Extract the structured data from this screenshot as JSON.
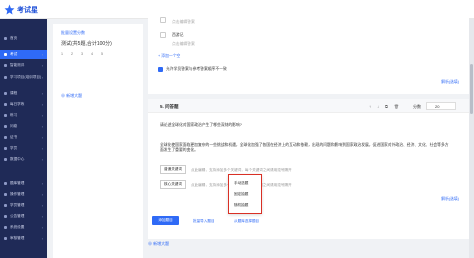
{
  "app": {
    "logo_text": "考试星"
  },
  "topbar": {
    "user": "靖哥用户名"
  },
  "sidebar": {
    "items": [
      {
        "label": "首页",
        "active": false,
        "has_arrow": false
      },
      {
        "label": "考试",
        "active": true,
        "has_arrow": true
      },
      {
        "label": "智能测评",
        "active": false,
        "has_arrow": true
      },
      {
        "label": "学习项目(培训项目)",
        "active": false,
        "has_arrow": true
      },
      {
        "label": "课程",
        "active": false,
        "has_arrow": true
      },
      {
        "label": "每日学练",
        "active": false,
        "has_arrow": true
      },
      {
        "label": "练习",
        "active": false,
        "has_arrow": true
      },
      {
        "label": "问卷",
        "active": false,
        "has_arrow": true
      },
      {
        "label": "证书",
        "active": false,
        "has_arrow": true
      },
      {
        "label": "学员",
        "active": false,
        "has_arrow": true
      },
      {
        "label": "数据中心",
        "active": false,
        "has_arrow": true
      },
      {
        "label": "题库管理",
        "active": false,
        "has_arrow": true
      },
      {
        "label": "操作管理",
        "active": false,
        "has_arrow": true
      },
      {
        "label": "学员管理",
        "active": false,
        "has_arrow": true
      },
      {
        "label": "公告管理",
        "active": false,
        "has_arrow": true
      },
      {
        "label": "系统设置",
        "active": false,
        "has_arrow": true
      },
      {
        "label": "审核管理",
        "active": false,
        "has_arrow": true
      }
    ]
  },
  "leftpanel": {
    "link": "批量设置分数",
    "title": "测试(共5题,合计100分)",
    "nums": [
      "1",
      "2",
      "3",
      "4",
      "5"
    ],
    "add": "新增大题"
  },
  "options": {
    "opt1_placeholder": "点击编辑答案",
    "opt2_text": "西游记",
    "opt2_placeholder": "点击编辑答案",
    "add_option": "添加一个空",
    "checkbox_label": "允许学员答案与参考答案顺序不一致",
    "parse_link": "解析(选填)"
  },
  "question": {
    "title": "5. 问答题",
    "score_label": "分数",
    "score": "20",
    "text1": "请论述全球化对国家政治产生了哪些深刻的影响?",
    "text2": "全球化使国家面临更加复杂的一些挑战和机遇，全球化加强了各国在经济上的互动和依赖，出现的问题和影响到国家政治发展，促进国家对外政治、经济、文化、社会等多方面发生了重要的变化。",
    "kw_btn1": "普通关键词",
    "kw_ph1": "点此编辑，支持添加多个关键词，每个关键词之间请用逗号隔开",
    "kw_btn2": "核心关键词",
    "kw_ph2": "点此编辑，支持添加多个关键词，每个关键词之间请用逗号隔开",
    "parse_link": "解析(选填)"
  },
  "dropdown": {
    "items": [
      "手动选题",
      "固定抽题",
      "随机抽题"
    ]
  },
  "actions": {
    "primary": "添加题目",
    "link1": "批量导入题目",
    "link2": "从题库选择题目",
    "add_more": "新增大题"
  },
  "colors": {
    "accent": "#2f6af6",
    "sidebar": "#1f2a57",
    "highlight": "#d93025"
  }
}
